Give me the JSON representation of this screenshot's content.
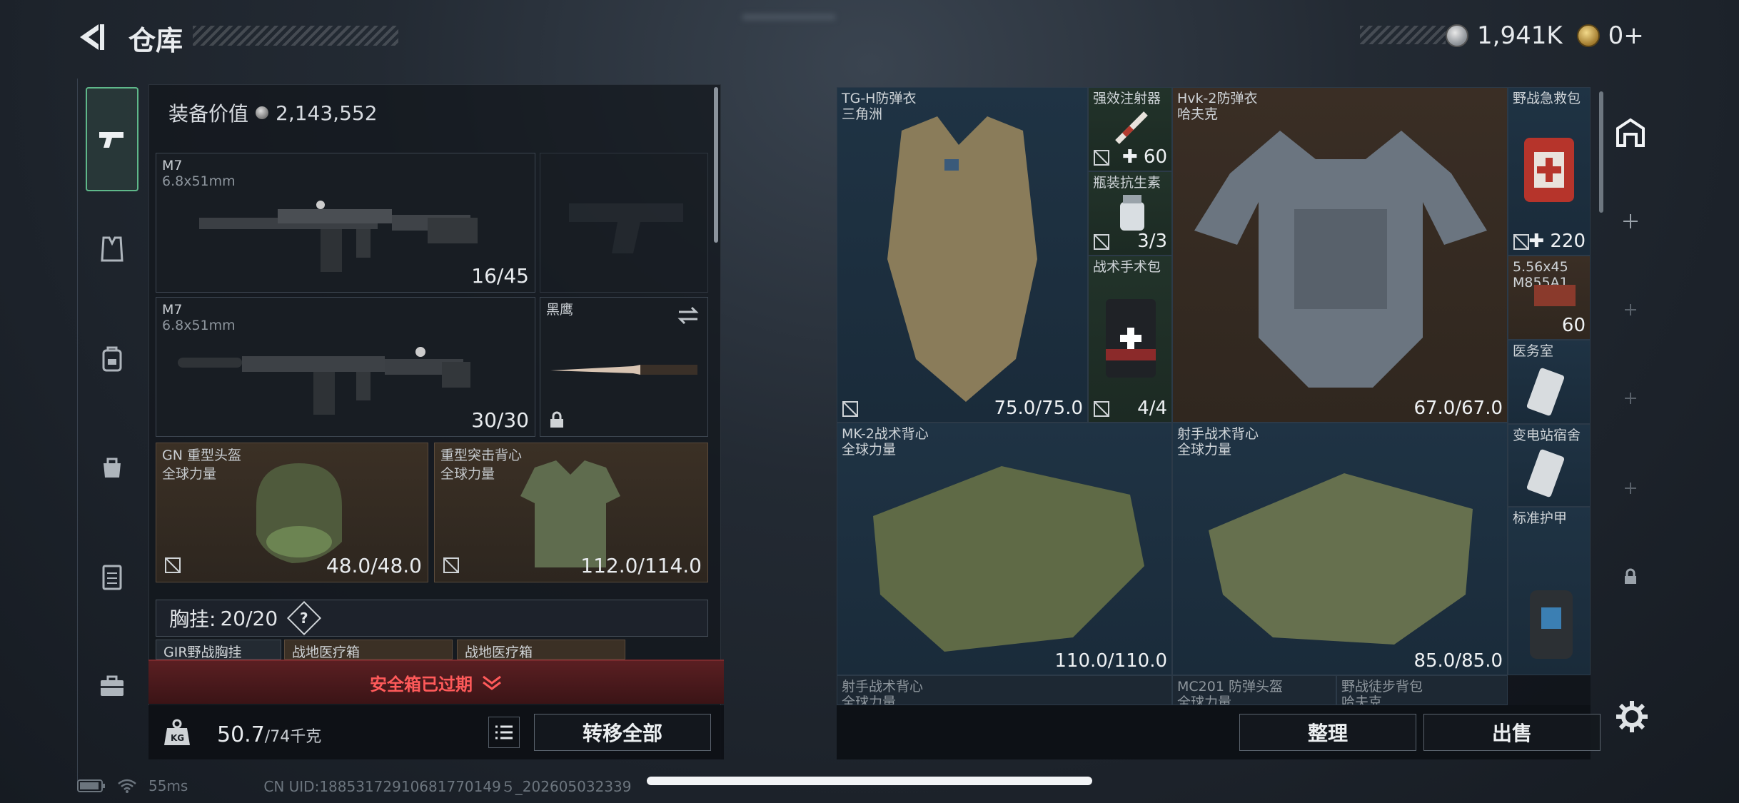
{
  "header": {
    "title": "仓库",
    "currency": "1,941K",
    "premium": "0+"
  },
  "left_tabs": [
    "pistol-icon",
    "vest-icon",
    "backpack-icon",
    "bag-icon",
    "clipboard-icon",
    "briefcase-icon"
  ],
  "loadout": {
    "gear_value_label": "装备价值",
    "gear_value": "2,143,552",
    "primary1": {
      "name": "M7",
      "caliber": "6.8x51mm",
      "ammo": "16/45"
    },
    "primary2": {
      "name": "M7",
      "caliber": "6.8x51mm",
      "ammo": "30/30"
    },
    "melee": {
      "name": "黑鹰"
    },
    "helmet": {
      "name": "GN 重型头盔",
      "faction": "全球力量",
      "durability": "48.0/48.0"
    },
    "armor": {
      "name": "重型突击背心",
      "faction": "全球力量",
      "durability": "112.0/114.0"
    },
    "chest_label": "胸挂:",
    "chest_count": "20/20",
    "chest_help": "?",
    "chest_items": [
      "GIR野战胸挂",
      "战地医疗箱",
      "战地医疗箱"
    ],
    "safe_box": "安全箱已过期",
    "weight": "50.7",
    "weight_max": "/74千克",
    "move_all": "转移全部"
  },
  "storage": [
    {
      "name": "TG-H防弹衣",
      "sub": "三角洲",
      "count": "75.0/75.0"
    },
    {
      "name": "强效注射器",
      "sub": "",
      "count": "✚ 60"
    },
    {
      "name": "瓶装抗生素",
      "sub": "",
      "count": "3/3"
    },
    {
      "name": "战术手术包",
      "sub": "",
      "count": "4/4"
    },
    {
      "name": "Hvk-2防弹衣",
      "sub": "哈夫克",
      "count": "67.0/67.0"
    },
    {
      "name": "野战急救包",
      "sub": "",
      "count": "✚ 220"
    },
    {
      "name": "5.56x45",
      "sub": "M855A1",
      "count": "60"
    },
    {
      "name": "医务室",
      "sub": "",
      "count": ""
    },
    {
      "name": "变电站宿舍",
      "sub": "",
      "count": ""
    },
    {
      "name": "标准护甲",
      "sub": "",
      "count": ""
    },
    {
      "name": "MK-2战术背心",
      "sub": "全球力量",
      "count": "110.0/110.0"
    },
    {
      "name": "射手战术背心",
      "sub": "全球力量",
      "count": "85.0/85.0"
    },
    {
      "name": "射手战术背心",
      "sub": "全球力量",
      "count": ""
    },
    {
      "name": "MC201 防弹头盔",
      "sub": "全球力量",
      "count": ""
    },
    {
      "name": "野战徒步背包",
      "sub": "哈夫克",
      "count": ""
    }
  ],
  "actions": {
    "sort": "整理",
    "sell": "出售"
  },
  "status": {
    "ping": "55ms",
    "uid": "CN UID:18853172910681770149５_202605032339"
  },
  "colors": {
    "accent_green": "#5fb88a",
    "danger": "#ff5a5a"
  }
}
